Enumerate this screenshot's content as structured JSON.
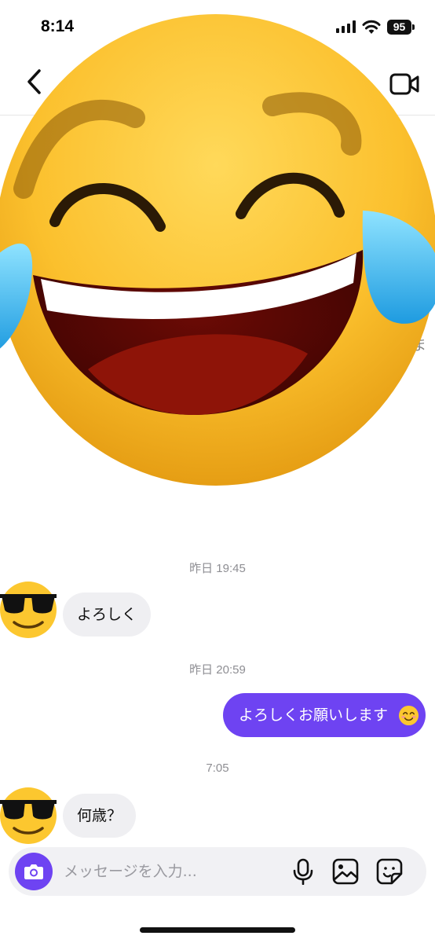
{
  "status_bar": {
    "time": "8:14",
    "battery": "95"
  },
  "header": {
    "back_icon": "chevron-left-icon",
    "video_icon": "video-camera-icon",
    "partial_text": "ま"
  },
  "overlay": {
    "emoji": "face-with-tears-of-joy"
  },
  "chat": {
    "messages": [
      {
        "timestamp": "昨日 19:45",
        "sender": "other",
        "avatar": "smiling-face-with-sunglasses",
        "text": "よろしく"
      },
      {
        "timestamp": "昨日 20:59",
        "sender": "me",
        "text": "よろしくお願いします",
        "emoji": "smiling-face-with-smiling-eyes"
      },
      {
        "timestamp": "7:05",
        "sender": "other",
        "avatar": "smiling-face-with-sunglasses",
        "text": "何歳？"
      }
    ]
  },
  "composer": {
    "placeholder": "メッセージを入力...",
    "value": "",
    "icons": [
      "camera-icon",
      "microphone-icon",
      "image-icon",
      "sticker-icon"
    ]
  },
  "colors": {
    "accent": "#6e43f2",
    "incoming_bubble": "#efeff2",
    "timestamp": "#8e8e93"
  }
}
